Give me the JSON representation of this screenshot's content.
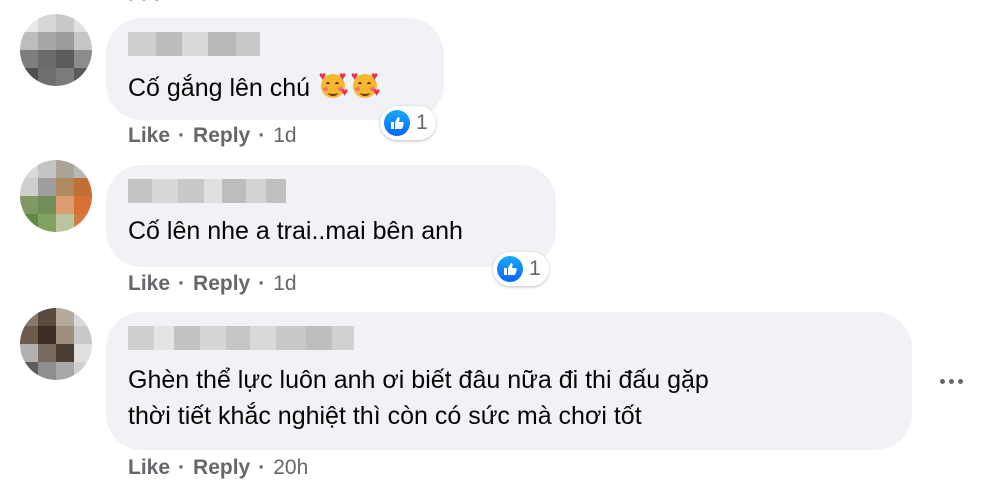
{
  "comments": [
    {
      "text_lines": [
        "Cố gắng lên chú"
      ],
      "emojis": [
        "smiling-face-with-hearts",
        "smiling-face-with-hearts"
      ],
      "reaction_count": "1",
      "actions": {
        "like": "Like",
        "reply": "Reply",
        "time": "1d"
      }
    },
    {
      "text_lines": [
        "Cố lên nhe a trai..mai bên anh"
      ],
      "reaction_count": "1",
      "actions": {
        "like": "Like",
        "reply": "Reply",
        "time": "1d"
      }
    },
    {
      "text_lines": [
        "Ghèn thể lực luôn anh ơi biết đâu nữa đi thi đấu gặp",
        "thời tiết khắc nghiệt thì còn có sức mà chơi tốt"
      ],
      "actions": {
        "like": "Like",
        "reply": "Reply",
        "time": "20h"
      }
    }
  ],
  "separator": "·",
  "colors": {
    "bubble": "#f0f2f5",
    "meta": "#65676b",
    "like_blue": "#0866ff"
  }
}
